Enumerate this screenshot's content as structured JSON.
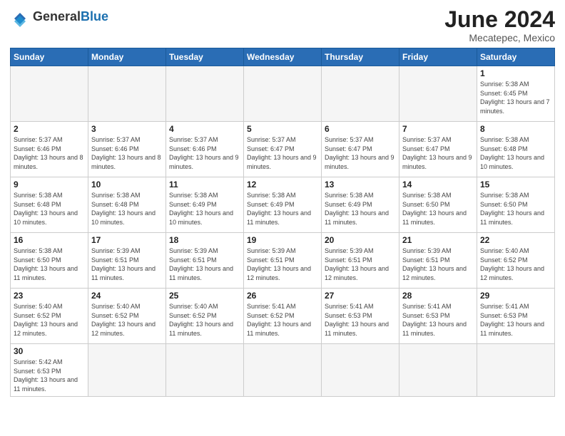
{
  "logo": {
    "general": "General",
    "blue": "Blue"
  },
  "title": "June 2024",
  "subtitle": "Mecatepec, Mexico",
  "days_of_week": [
    "Sunday",
    "Monday",
    "Tuesday",
    "Wednesday",
    "Thursday",
    "Friday",
    "Saturday"
  ],
  "weeks": [
    [
      {
        "day": "",
        "info": ""
      },
      {
        "day": "",
        "info": ""
      },
      {
        "day": "",
        "info": ""
      },
      {
        "day": "",
        "info": ""
      },
      {
        "day": "",
        "info": ""
      },
      {
        "day": "",
        "info": ""
      },
      {
        "day": "1",
        "info": "Sunrise: 5:38 AM\nSunset: 6:45 PM\nDaylight: 13 hours and 7 minutes."
      }
    ],
    [
      {
        "day": "2",
        "info": "Sunrise: 5:37 AM\nSunset: 6:46 PM\nDaylight: 13 hours and 8 minutes."
      },
      {
        "day": "3",
        "info": "Sunrise: 5:37 AM\nSunset: 6:46 PM\nDaylight: 13 hours and 8 minutes."
      },
      {
        "day": "4",
        "info": "Sunrise: 5:37 AM\nSunset: 6:46 PM\nDaylight: 13 hours and 9 minutes."
      },
      {
        "day": "5",
        "info": "Sunrise: 5:37 AM\nSunset: 6:47 PM\nDaylight: 13 hours and 9 minutes."
      },
      {
        "day": "6",
        "info": "Sunrise: 5:37 AM\nSunset: 6:47 PM\nDaylight: 13 hours and 9 minutes."
      },
      {
        "day": "7",
        "info": "Sunrise: 5:37 AM\nSunset: 6:47 PM\nDaylight: 13 hours and 9 minutes."
      },
      {
        "day": "8",
        "info": "Sunrise: 5:38 AM\nSunset: 6:48 PM\nDaylight: 13 hours and 10 minutes."
      }
    ],
    [
      {
        "day": "9",
        "info": "Sunrise: 5:38 AM\nSunset: 6:48 PM\nDaylight: 13 hours and 10 minutes."
      },
      {
        "day": "10",
        "info": "Sunrise: 5:38 AM\nSunset: 6:48 PM\nDaylight: 13 hours and 10 minutes."
      },
      {
        "day": "11",
        "info": "Sunrise: 5:38 AM\nSunset: 6:49 PM\nDaylight: 13 hours and 10 minutes."
      },
      {
        "day": "12",
        "info": "Sunrise: 5:38 AM\nSunset: 6:49 PM\nDaylight: 13 hours and 11 minutes."
      },
      {
        "day": "13",
        "info": "Sunrise: 5:38 AM\nSunset: 6:49 PM\nDaylight: 13 hours and 11 minutes."
      },
      {
        "day": "14",
        "info": "Sunrise: 5:38 AM\nSunset: 6:50 PM\nDaylight: 13 hours and 11 minutes."
      },
      {
        "day": "15",
        "info": "Sunrise: 5:38 AM\nSunset: 6:50 PM\nDaylight: 13 hours and 11 minutes."
      }
    ],
    [
      {
        "day": "16",
        "info": "Sunrise: 5:38 AM\nSunset: 6:50 PM\nDaylight: 13 hours and 11 minutes."
      },
      {
        "day": "17",
        "info": "Sunrise: 5:39 AM\nSunset: 6:51 PM\nDaylight: 13 hours and 11 minutes."
      },
      {
        "day": "18",
        "info": "Sunrise: 5:39 AM\nSunset: 6:51 PM\nDaylight: 13 hours and 11 minutes."
      },
      {
        "day": "19",
        "info": "Sunrise: 5:39 AM\nSunset: 6:51 PM\nDaylight: 13 hours and 12 minutes."
      },
      {
        "day": "20",
        "info": "Sunrise: 5:39 AM\nSunset: 6:51 PM\nDaylight: 13 hours and 12 minutes."
      },
      {
        "day": "21",
        "info": "Sunrise: 5:39 AM\nSunset: 6:51 PM\nDaylight: 13 hours and 12 minutes."
      },
      {
        "day": "22",
        "info": "Sunrise: 5:40 AM\nSunset: 6:52 PM\nDaylight: 13 hours and 12 minutes."
      }
    ],
    [
      {
        "day": "23",
        "info": "Sunrise: 5:40 AM\nSunset: 6:52 PM\nDaylight: 13 hours and 12 minutes."
      },
      {
        "day": "24",
        "info": "Sunrise: 5:40 AM\nSunset: 6:52 PM\nDaylight: 13 hours and 12 minutes."
      },
      {
        "day": "25",
        "info": "Sunrise: 5:40 AM\nSunset: 6:52 PM\nDaylight: 13 hours and 11 minutes."
      },
      {
        "day": "26",
        "info": "Sunrise: 5:41 AM\nSunset: 6:52 PM\nDaylight: 13 hours and 11 minutes."
      },
      {
        "day": "27",
        "info": "Sunrise: 5:41 AM\nSunset: 6:53 PM\nDaylight: 13 hours and 11 minutes."
      },
      {
        "day": "28",
        "info": "Sunrise: 5:41 AM\nSunset: 6:53 PM\nDaylight: 13 hours and 11 minutes."
      },
      {
        "day": "29",
        "info": "Sunrise: 5:41 AM\nSunset: 6:53 PM\nDaylight: 13 hours and 11 minutes."
      }
    ],
    [
      {
        "day": "30",
        "info": "Sunrise: 5:42 AM\nSunset: 6:53 PM\nDaylight: 13 hours and 11 minutes."
      },
      {
        "day": "",
        "info": ""
      },
      {
        "day": "",
        "info": ""
      },
      {
        "day": "",
        "info": ""
      },
      {
        "day": "",
        "info": ""
      },
      {
        "day": "",
        "info": ""
      },
      {
        "day": "",
        "info": ""
      }
    ]
  ]
}
